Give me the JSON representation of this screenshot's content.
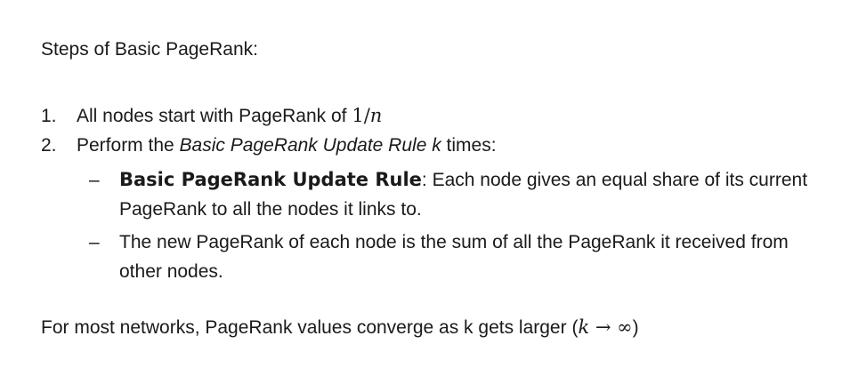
{
  "heading": "Steps of Basic PageRank:",
  "step1": {
    "number": "1.",
    "text": "All nodes start with PageRank of ",
    "math_num": "1",
    "math_slash": "/",
    "math_den": "n"
  },
  "step2": {
    "number": "2.",
    "text_before": "Perform the ",
    "text_italic": "Basic PageRank Update Rule k",
    "text_after": " times:"
  },
  "sub1": {
    "dash": "–",
    "bold": "Basic PageRank Update Rule",
    "colon": ":",
    "text": " Each node gives an equal share of its current PageRank to all the nodes it links to."
  },
  "sub2": {
    "dash": "–",
    "text": "The new PageRank of each node is the sum of all the PageRank it received from other nodes."
  },
  "footer": {
    "text": "For most networks, PageRank values converge as k gets larger (",
    "math_k": "k",
    "arrow": " → ",
    "infinity": "∞",
    "close": ")"
  }
}
